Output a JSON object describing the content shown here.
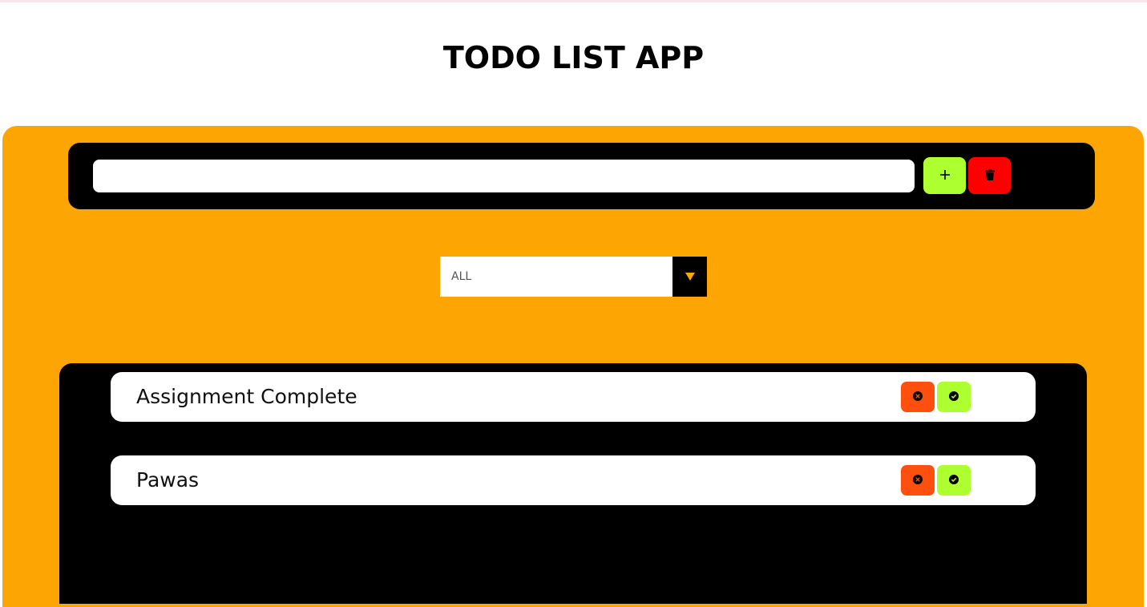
{
  "app": {
    "title": "TODO LIST APP"
  },
  "input_bar": {
    "task_input_value": "",
    "task_input_placeholder": "",
    "add_icon": "plus-icon",
    "delete_icon": "trash-icon"
  },
  "filter": {
    "selected": "ALL",
    "arrow_icon": "triangle-down-icon"
  },
  "todos": [
    {
      "text": "Assignment Complete",
      "remove_icon": "x-circle-icon",
      "complete_icon": "check-circle-icon"
    },
    {
      "text": "Pawas",
      "remove_icon": "x-circle-icon",
      "complete_icon": "check-circle-icon"
    }
  ],
  "colors": {
    "panel": "#fca503",
    "dark": "#000000",
    "add": "#adff2f",
    "delete": "#ff0000",
    "remove_item": "#ff4f0f",
    "complete_item": "#adff2f"
  }
}
